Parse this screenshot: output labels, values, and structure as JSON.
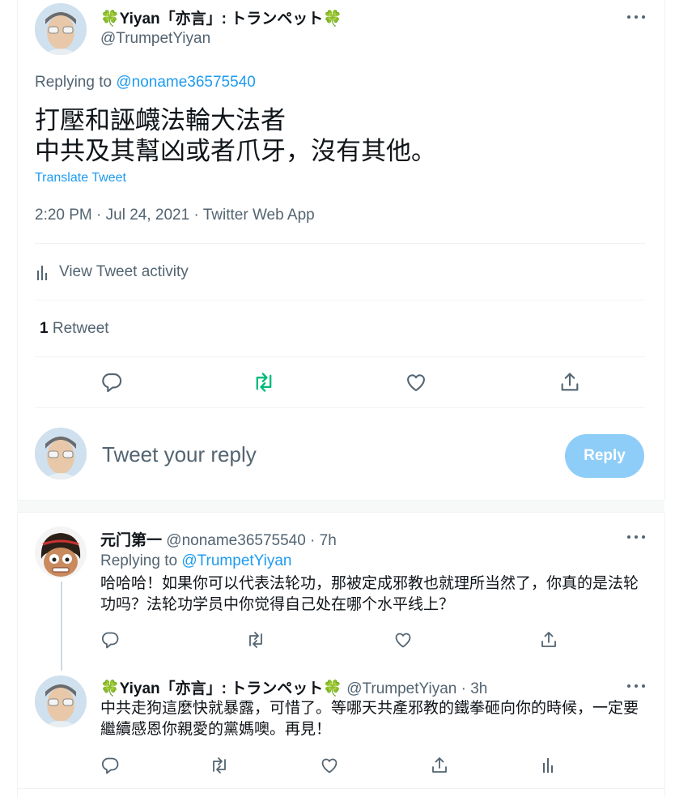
{
  "main_tweet": {
    "author_name": "🍀Yiyan「亦言」: トランペット🍀",
    "author_handle": "@TrumpetYiyan",
    "replying_prefix": "Replying to",
    "replying_to": "@noname36575540",
    "text_line1": "打壓和誣衊法輪大法者",
    "text_line2": "中共及其幫凶或者爪牙，沒有其他。",
    "translate_label": "Translate Tweet",
    "meta": "2:20 PM · Jul 24, 2021 · Twitter Web App",
    "activity_label": "View Tweet activity",
    "retweet_count": "1",
    "retweet_label": "Retweet"
  },
  "compose": {
    "placeholder": "Tweet your reply",
    "button_label": "Reply"
  },
  "replies": [
    {
      "author_name": "元门第一",
      "handle_time": "@noname36575540 · 7h",
      "replying_prefix": "Replying to",
      "replying_to": "@TrumpetYiyan",
      "text": "哈哈哈！如果你可以代表法轮功，那被定成邪教也就理所当然了，你真的是法轮功吗？法轮功学员中你觉得自己处在哪个水平线上？"
    },
    {
      "author_name": "🍀Yiyan「亦言」: トランペット🍀",
      "handle_time": "@TrumpetYiyan · 3h",
      "text": "中共走狗這麼快就暴露，可惜了。等哪天共產邪教的鐵拳砸向你的時候，一定要繼續感恩你親愛的黨媽噢。再見！"
    }
  ],
  "colors": {
    "accent": "#1d9bf0",
    "retweeted_green": "#00ba7c",
    "reply_button_disabled": "#8ecdf8",
    "muted_text": "#536471"
  },
  "icons": [
    "more-icon",
    "analytics-icon",
    "reply-icon",
    "retweet-icon",
    "like-icon",
    "share-icon",
    "clover-icon"
  ]
}
